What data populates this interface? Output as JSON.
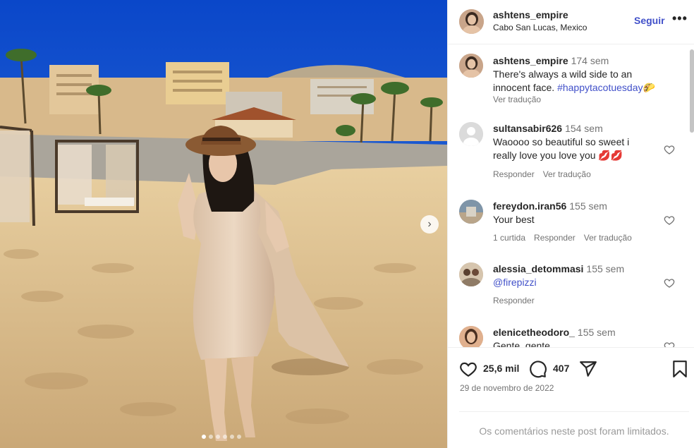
{
  "post": {
    "username": "ashtens_empire",
    "location": "Cabo San Lucas, Mexico",
    "follow_label": "Seguir",
    "more_label": "•••"
  },
  "caption": {
    "username": "ashtens_empire",
    "time": "174 sem",
    "text": "There's always a wild side to an innocent face.",
    "hashtag": "#happytacotuesday",
    "emoji": "🌮",
    "translate_label": "Ver tradução"
  },
  "comments": [
    {
      "username": "sultansabir626",
      "time": "154 sem",
      "text": "Waoooo so beautiful so sweet i really love you love you 💋💋",
      "reply_label": "Responder",
      "translate_label": "Ver tradução"
    },
    {
      "username": "fereydon.iran56",
      "time": "155 sem",
      "text": "Your best",
      "likes_label": "1 curtida",
      "reply_label": "Responder",
      "translate_label": "Ver tradução"
    },
    {
      "username": "alessia_detommasi",
      "time": "155 sem",
      "mention": "@firepizzi",
      "reply_label": "Responder"
    },
    {
      "username": "elenicetheodoro_",
      "time": "155 sem",
      "text": "Gente, gente"
    }
  ],
  "stats": {
    "likes": "25,6 mil",
    "comments": "407",
    "date": "29 de novembro de 2022"
  },
  "footer": {
    "limited_text": "Os comentários neste post foram limitados."
  },
  "icons": {
    "heart": "heart-icon",
    "comment": "comment-icon",
    "share": "share-icon",
    "save": "bookmark-icon",
    "next": "chevron-right-icon"
  },
  "colors": {
    "accent": "#4150c9",
    "muted": "#737373"
  },
  "carousel": {
    "total": 6,
    "active": 1
  }
}
